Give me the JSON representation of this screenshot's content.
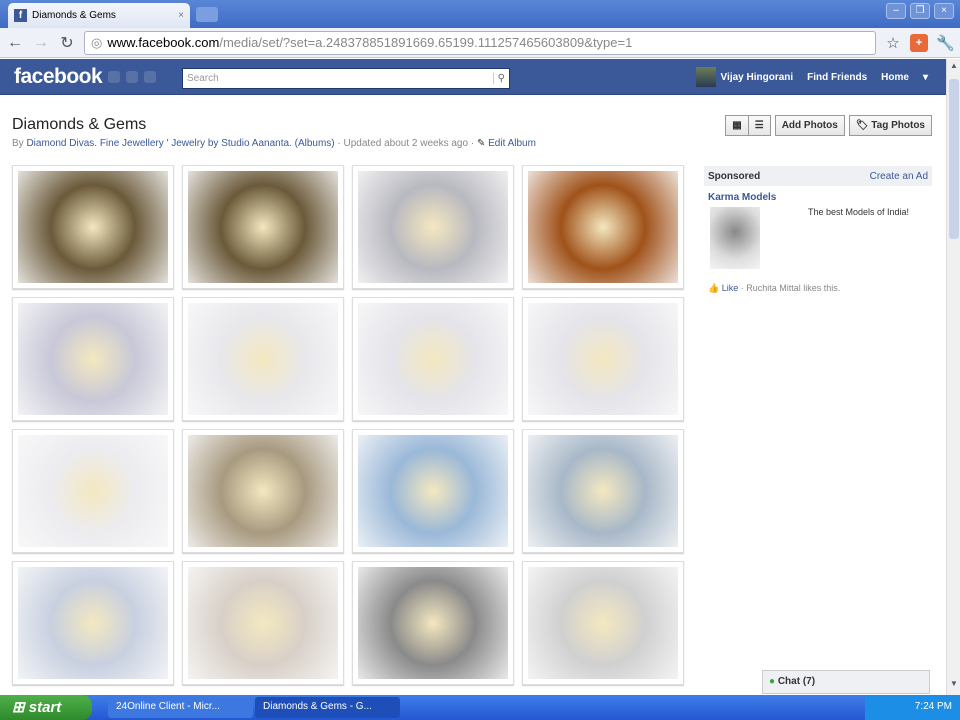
{
  "browser": {
    "tab_title": "Diamonds & Gems",
    "url_host": "www.facebook.com",
    "url_path": "/media/set/?set=a.248378851891669.65199.111257465603809&type=1"
  },
  "fb": {
    "logo": "facebook",
    "search_placeholder": "Search",
    "user": "Vijay Hingorani",
    "find_friends": "Find Friends",
    "home": "Home"
  },
  "album": {
    "title": "Diamonds & Gems",
    "by": "By",
    "author": "Diamond Divas. Fine Jewellery ' Jewelry by Studio Aananta.",
    "albums_link": "(Albums)",
    "updated": "· Updated about 2 weeks ago ·",
    "edit": "Edit Album",
    "add_photos": "Add Photos",
    "tag_photos": "Tag Photos"
  },
  "photos": [
    {
      "tone": "#6b5a3a"
    },
    {
      "tone": "#6b5a3a"
    },
    {
      "tone": "#b8b8c0"
    },
    {
      "tone": "#a0521a"
    },
    {
      "tone": "#c8c8d8"
    },
    {
      "tone": "#e8e8ec"
    },
    {
      "tone": "#e4e4ea"
    },
    {
      "tone": "#e4e4ea"
    },
    {
      "tone": "#ececf0"
    },
    {
      "tone": "#a89a80"
    },
    {
      "tone": "#9ab8d8"
    },
    {
      "tone": "#a8b8c8"
    },
    {
      "tone": "#c8d0e0"
    },
    {
      "tone": "#d8d0c8"
    },
    {
      "tone": "#8a8a8a"
    },
    {
      "tone": "#d0d0d0"
    }
  ],
  "sidebar": {
    "sponsored": "Sponsored",
    "create_ad": "Create an Ad",
    "ad_title": "Karma Models",
    "ad_text": "The best Models of India!",
    "like": "Like",
    "like_text": "· Ruchita Mittal likes this."
  },
  "chat": {
    "label": "Chat (7)"
  },
  "taskbar": {
    "start": "start",
    "task1": "24Online Client - Micr...",
    "task2": "Diamonds & Gems - G...",
    "clock": "7:24 PM"
  }
}
